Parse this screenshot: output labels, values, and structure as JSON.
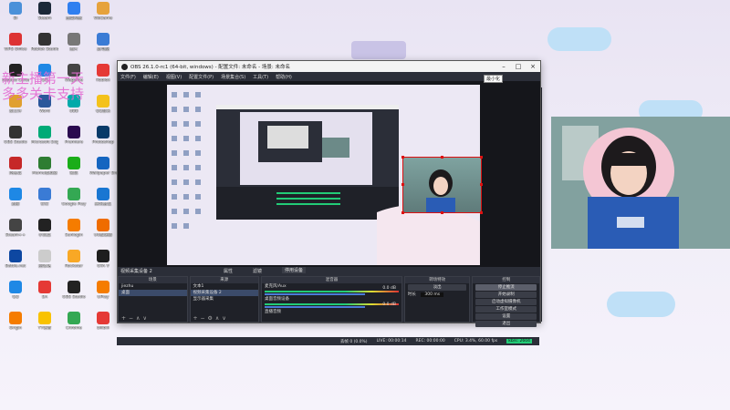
{
  "desktop": {
    "icons": [
      {
        "label": "Bi",
        "color": "#4a90d9"
      },
      {
        "label": "Steam",
        "color": "#1b2838"
      },
      {
        "label": "百度网盘",
        "color": "#2f7ff0"
      },
      {
        "label": "WeGame",
        "color": "#e6a23c"
      },
      {
        "label": "WPS Office",
        "color": "#d33"
      },
      {
        "label": "Roblox Studio",
        "color": "#333"
      },
      {
        "label": "图片",
        "color": "#777"
      },
      {
        "label": "此电脑",
        "color": "#3a7bd5"
      },
      {
        "label": "Assetto Corsa",
        "color": "#222"
      },
      {
        "label": "QQ",
        "color": "#1e88e5"
      },
      {
        "label": "Wegame",
        "color": "#444"
      },
      {
        "label": "Roblox",
        "color": "#e53935"
      },
      {
        "label": "新文件",
        "color": "#e0a030"
      },
      {
        "label": "Word",
        "color": "#2b579a"
      },
      {
        "label": "UBB",
        "color": "#0aa"
      },
      {
        "label": "QQ音乐",
        "color": "#f4c21b"
      },
      {
        "label": "OBS Studio",
        "color": "#333"
      },
      {
        "label": "Microsoft Edge",
        "color": "#0a7"
      },
      {
        "label": "Premiere",
        "color": "#2a0a4f"
      },
      {
        "label": "Photoshop",
        "color": "#083a69"
      },
      {
        "label": "网易云",
        "color": "#c62828"
      },
      {
        "label": "Mumu模拟器",
        "color": "#2e7d32"
      },
      {
        "label": "微信",
        "color": "#1aad19"
      },
      {
        "label": "Wallpaper Engine",
        "color": "#1565c0"
      },
      {
        "label": "迅雷",
        "color": "#1e88e5"
      },
      {
        "label": "钉钉",
        "color": "#3a7bd5"
      },
      {
        "label": "Google Play",
        "color": "#34a853"
      },
      {
        "label": "腾讯会议",
        "color": "#1976d2"
      },
      {
        "label": "Steam++",
        "color": "#444"
      },
      {
        "label": "小黑盒",
        "color": "#222"
      },
      {
        "label": "Sunlogin",
        "color": "#f57c00"
      },
      {
        "label": "UU加速器",
        "color": "#ef6c00"
      },
      {
        "label": "Battle.net",
        "color": "#0d47a1"
      },
      {
        "label": "回收站",
        "color": "#ccc"
      },
      {
        "label": "Rockstar",
        "color": "#f9a825"
      },
      {
        "label": "GTA V",
        "color": "#1e1e1e"
      },
      {
        "label": "QQ",
        "color": "#1e88e5"
      },
      {
        "label": "EA",
        "color": "#e53935"
      },
      {
        "label": "OBS Studio",
        "color": "#222"
      },
      {
        "label": "UPlay",
        "color": "#f57c00"
      },
      {
        "label": "Origin",
        "color": "#f57c00"
      },
      {
        "label": "YY语音",
        "color": "#f9c200"
      },
      {
        "label": "Chrome",
        "color": "#34a853"
      },
      {
        "label": "bilibili",
        "color": "#e53935"
      }
    ],
    "overlay_text": "新主播第一天\n多多关卡支持"
  },
  "obs": {
    "title": "OBS 26.1.0-rc1 (64-bit, windows) - 配置文件: 未命名 - 场景: 未命名",
    "menu": [
      "文件(F)",
      "编辑(E)",
      "视图(V)",
      "配置文件(P)",
      "场景集合(S)",
      "工具(T)",
      "帮助(H)"
    ],
    "tooltip": "最小化",
    "toolbar": {
      "source_label": "视频采集设备 2",
      "properties": "属性",
      "filters": "滤镜",
      "device": "停用设备"
    },
    "docks": {
      "scenes": {
        "title": "场景",
        "items": [
          "jiezhu",
          "桌面"
        ]
      },
      "sources": {
        "title": "来源",
        "items": [
          "文本1",
          "视频采集设备 2",
          "显示器采集"
        ]
      },
      "mixer": {
        "title": "混音器",
        "channels": [
          "麦克风/Aux",
          "桌面音频设备",
          "直播音频"
        ],
        "db": [
          "0.0 dB",
          "0.0 dB",
          "0.0 dB"
        ]
      },
      "transitions": {
        "title": "转场特效",
        "type": "淡出",
        "duration_label": "时长",
        "duration": "300 ms"
      },
      "controls": {
        "title": "控制",
        "buttons": [
          "停止推流",
          "开始录制",
          "启动虚拟摄像机",
          "工作室模式",
          "设置",
          "退出"
        ]
      }
    },
    "status": {
      "dropped": "丢帧 0 (0.0%)",
      "live": "LIVE: 00:00:14",
      "rec": "REC: 00:00:00",
      "cpu": "CPU: 3.4%, 60.00 fps",
      "bitrate": "kb/s: 2604"
    }
  }
}
